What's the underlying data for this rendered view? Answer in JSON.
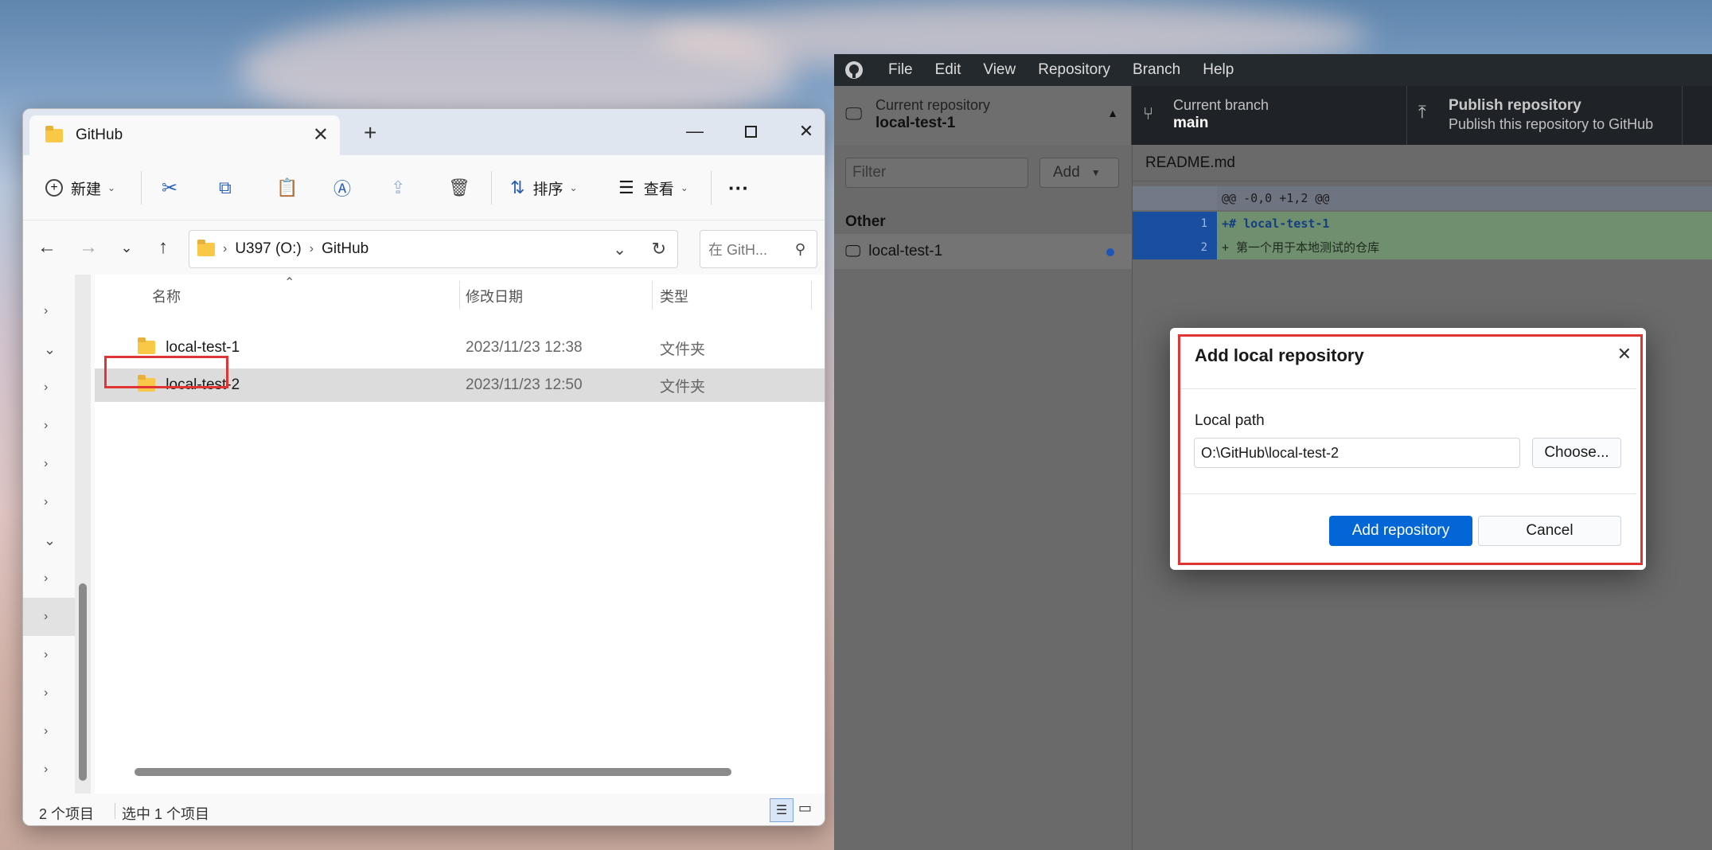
{
  "explorer": {
    "tab_title": "GitHub",
    "toolbar": {
      "new_label": "新建",
      "sort_label": "排序",
      "view_label": "查看"
    },
    "address": {
      "drive": "U397 (O:)",
      "folder": "GitHub"
    },
    "search_placeholder": "在 GitH...",
    "columns": [
      "名称",
      "修改日期",
      "类型"
    ],
    "files": [
      {
        "name": "local-test-1",
        "date": "2023/11/23 12:38",
        "type": "文件夹"
      },
      {
        "name": "local-test-2",
        "date": "2023/11/23 12:50",
        "type": "文件夹"
      }
    ],
    "status": {
      "count": "2 个项目",
      "selected": "选中 1 个项目"
    }
  },
  "github": {
    "menu": [
      "File",
      "Edit",
      "View",
      "Repository",
      "Branch",
      "Help"
    ],
    "current_repo_label": "Current repository",
    "current_repo": "local-test-1",
    "current_branch_label": "Current branch",
    "current_branch": "main",
    "publish_title": "Publish repository",
    "publish_subtitle": "Publish this repository to GitHub",
    "filter_placeholder": "Filter",
    "add_label": "Add",
    "group_header": "Other",
    "repo_item": "local-test-1",
    "diff_file": "README.md",
    "diff_lines": [
      {
        "ln": "",
        "code": "@@ -0,0 +1,2 @@"
      },
      {
        "ln": "1",
        "code": "+# local-test-1"
      },
      {
        "ln": "2",
        "code": "+ 第一个用于本地测试的仓库"
      }
    ]
  },
  "dialog": {
    "title": "Add local repository",
    "local_path_label": "Local path",
    "local_path_value": "O:\\GitHub\\local-test-2",
    "choose_label": "Choose...",
    "add_button": "Add repository",
    "cancel_button": "Cancel"
  },
  "colors": {
    "accent_blue": "#0366d6",
    "highlight_red": "#e03535",
    "diff_added_bg": "#6f8f6f"
  }
}
